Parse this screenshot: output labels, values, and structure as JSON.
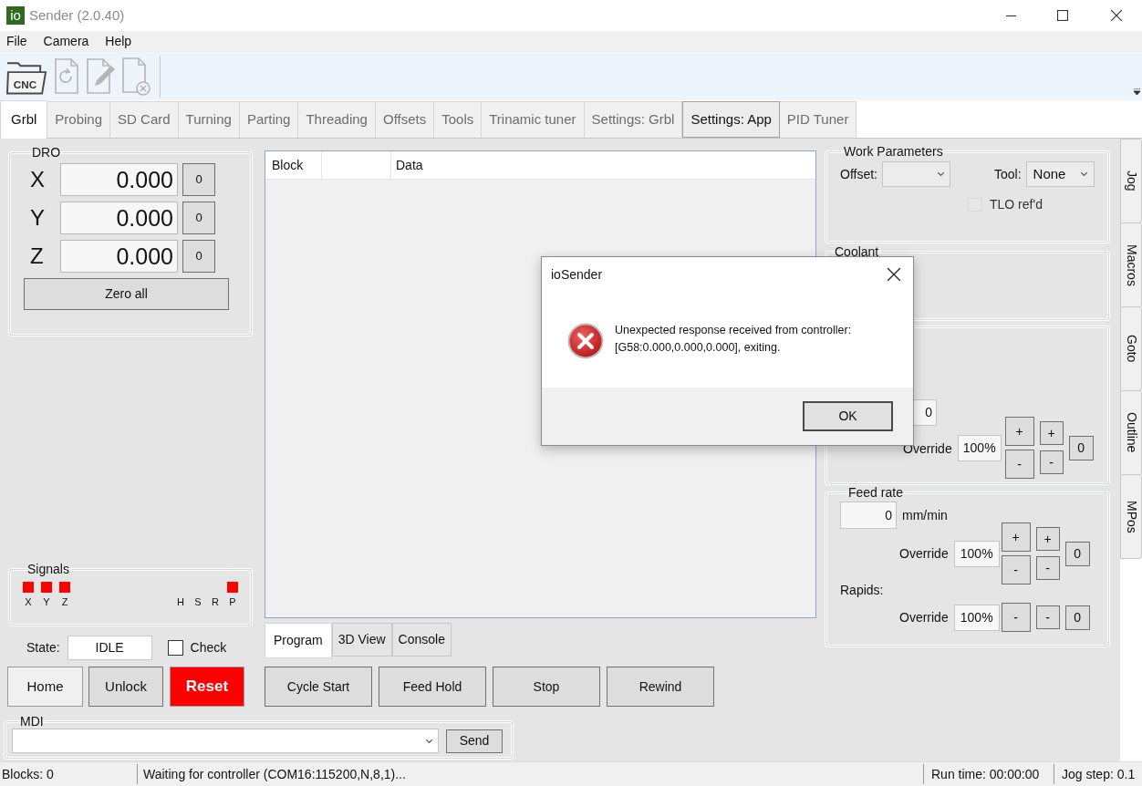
{
  "window": {
    "title": "Sender (2.0.40)",
    "app_badge": "io"
  },
  "menu": [
    "File",
    "Camera",
    "Help"
  ],
  "toolbar": [
    {
      "kind": "open",
      "label": "CNC",
      "disabled": false
    },
    {
      "kind": "reload",
      "disabled": true
    },
    {
      "kind": "edit",
      "disabled": true
    },
    {
      "kind": "close",
      "disabled": true
    }
  ],
  "tabs": [
    {
      "label": "Grbl",
      "selected": true,
      "hovered": false
    },
    {
      "label": "Probing",
      "selected": false,
      "hovered": false
    },
    {
      "label": "SD Card",
      "selected": false,
      "hovered": false
    },
    {
      "label": "Turning",
      "selected": false,
      "hovered": false
    },
    {
      "label": "Parting",
      "selected": false,
      "hovered": false
    },
    {
      "label": "Threading",
      "selected": false,
      "hovered": false
    },
    {
      "label": "Offsets",
      "selected": false,
      "hovered": false
    },
    {
      "label": "Tools",
      "selected": false,
      "hovered": false
    },
    {
      "label": "Trinamic tuner",
      "selected": false,
      "hovered": false
    },
    {
      "label": "Settings: Grbl",
      "selected": false,
      "hovered": false
    },
    {
      "label": "Settings: App",
      "selected": false,
      "hovered": true
    },
    {
      "label": "PID Tuner",
      "selected": false,
      "hovered": false
    }
  ],
  "dro": {
    "title": "DRO",
    "axes": [
      {
        "label": "X",
        "value": "0.000",
        "zero": "0"
      },
      {
        "label": "Y",
        "value": "0.000",
        "zero": "0"
      },
      {
        "label": "Z",
        "value": "0.000",
        "zero": "0"
      }
    ],
    "zero_all": "Zero all"
  },
  "signals": {
    "title": "Signals",
    "items": [
      {
        "label": "X",
        "active": true
      },
      {
        "label": "Y",
        "active": true
      },
      {
        "label": "Z",
        "active": true
      },
      {
        "label": "H",
        "active": false
      },
      {
        "label": "S",
        "active": false
      },
      {
        "label": "R",
        "active": false
      },
      {
        "label": "P",
        "active": true
      }
    ]
  },
  "state": {
    "label": "State:",
    "value": "IDLE"
  },
  "check": {
    "label": "Check",
    "checked": false
  },
  "control_buttons": [
    {
      "label": "Home",
      "kind": "light"
    },
    {
      "label": "Unlock",
      "kind": "normal"
    },
    {
      "label": "Reset",
      "kind": "danger"
    }
  ],
  "program_grid": {
    "columns": [
      "Block",
      "Data"
    ]
  },
  "view_tabs": [
    {
      "label": "Program",
      "selected": true
    },
    {
      "label": "3D View",
      "selected": false
    },
    {
      "label": "Console",
      "selected": false
    }
  ],
  "job_buttons": [
    "Cycle Start",
    "Feed Hold",
    "Stop",
    "Rewind"
  ],
  "mdi": {
    "title": "MDI",
    "send": "Send"
  },
  "work_parameters": {
    "title": "Work Parameters",
    "offset_label": "Offset:",
    "tool_label": "Tool:",
    "tool_value": "None",
    "tlo": {
      "label": "TLO ref'd",
      "checked": false,
      "disabled": true
    }
  },
  "coolant": {
    "title": "Coolant"
  },
  "spindle": {
    "value": "0",
    "override_label": "Override",
    "override": "100%",
    "buttons": {
      "coarse_up": "+",
      "coarse_down": "-",
      "fine_up": "+",
      "fine_down": "-",
      "reset": "0"
    }
  },
  "feed_rate": {
    "title": "Feed rate",
    "value": "0",
    "unit": "mm/min",
    "override_label": "Override",
    "override": "100%",
    "buttons": {
      "coarse_up": "+",
      "coarse_down": "-",
      "fine_up": "+",
      "fine_down": "-",
      "reset": "0"
    },
    "rapids_label": "Rapids:",
    "rapids_override_label": "Override",
    "rapids_override": "100%",
    "rapids_buttons": [
      "-",
      "-",
      "0"
    ]
  },
  "side_tabs": [
    "Jog",
    "Macros",
    "Goto",
    "Outline",
    "MPos"
  ],
  "status_bar": {
    "blocks": "Blocks: 0",
    "message": "Waiting for controller (COM16:115200,N,8,1)...",
    "run_time": "Run time: 00:00:00",
    "jog_step": "Jog step: 0.1"
  },
  "dialog": {
    "title": "ioSender",
    "kind": "error",
    "message": "Unexpected response received from controller:\n[G58:0.000,0.000,0.000], exiting.",
    "ok": "OK"
  }
}
